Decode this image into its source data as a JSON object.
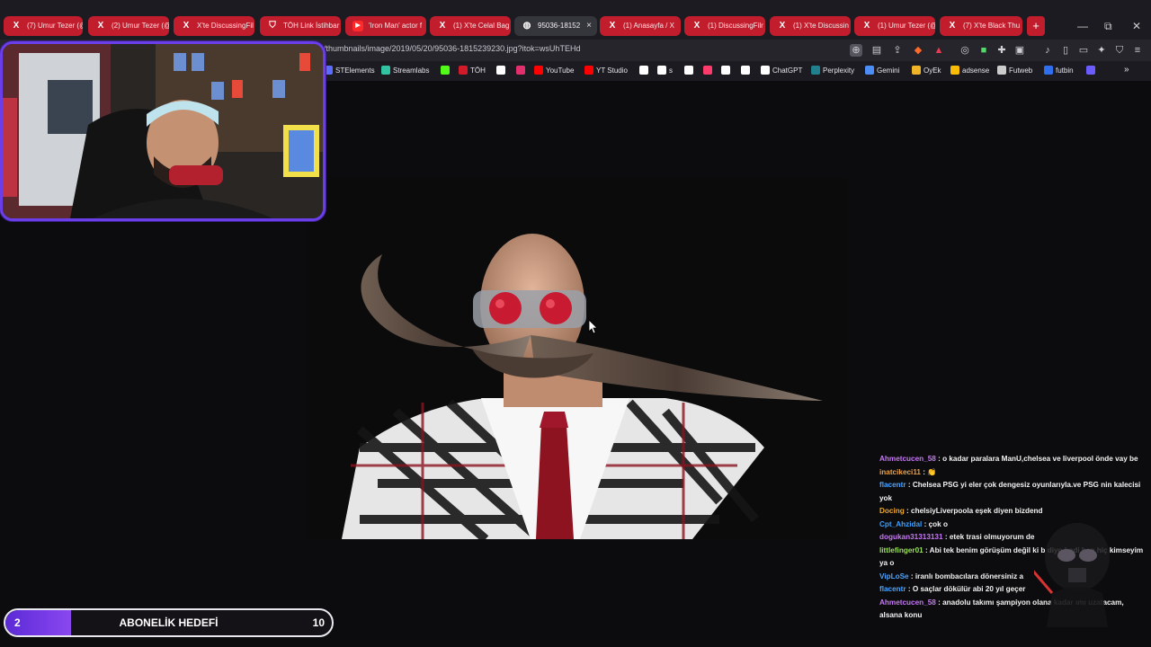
{
  "browser": {
    "tabs": [
      {
        "label": "(7) Umur Tezer (@",
        "icon": "x-icon",
        "style": "red"
      },
      {
        "label": "(2) Umur Tezer (@",
        "icon": "x-icon",
        "style": "red"
      },
      {
        "label": "X'te DiscussingFil",
        "icon": "x-icon",
        "style": "red"
      },
      {
        "label": "TÖH Link İstihbar",
        "icon": "shield-icon",
        "style": "red"
      },
      {
        "label": "'Iron Man' actor f",
        "icon": "youtube-icon",
        "style": "red"
      },
      {
        "label": "(1) X'te Celal Bag",
        "icon": "x-icon",
        "style": "red"
      },
      {
        "label": "95036-18152",
        "icon": "globe-icon",
        "style": "active",
        "close": "×"
      },
      {
        "label": "(1) Anasayfa / X",
        "icon": "x-icon",
        "style": "red"
      },
      {
        "label": "(1) DiscussingFilr",
        "icon": "x-icon",
        "style": "red"
      },
      {
        "label": "(1) X'te Discussin",
        "icon": "x-icon",
        "style": "red"
      },
      {
        "label": "(1) Umur Tezer (@",
        "icon": "x-icon",
        "style": "red"
      },
      {
        "label": "(7) X'te Black Thu",
        "icon": "x-icon",
        "style": "red"
      }
    ],
    "new_tab": "+",
    "window_controls": {
      "minimize": "—",
      "restore": "⧉",
      "close": "✕"
    },
    "url": "/thumbnails/image/2019/05/20/95036-1815239230.jpg?itok=wsUhTEHd",
    "bookmarks": [
      {
        "label": "STElements",
        "color": "#5b6cff"
      },
      {
        "label": "Streamlabs",
        "color": "#31c3a2"
      },
      {
        "label": "",
        "color": "#53fc18"
      },
      {
        "label": "TÖH",
        "color": "#d11a2a"
      },
      {
        "label": "",
        "color": "#ffffff"
      },
      {
        "label": "",
        "color": "#e1306c"
      },
      {
        "label": "YouTube",
        "color": "#ff0000"
      },
      {
        "label": "YT Studio",
        "color": "#ff0000"
      },
      {
        "label": "",
        "color": "#ffffff"
      },
      {
        "label": "s",
        "color": "#ffffff"
      },
      {
        "label": "",
        "color": "#ffffff"
      },
      {
        "label": "",
        "color": "#ff3b6b"
      },
      {
        "label": "",
        "color": "#ffffff"
      },
      {
        "label": "",
        "color": "#ffffff"
      },
      {
        "label": "ChatGPT",
        "color": "#ffffff"
      },
      {
        "label": "Perplexity",
        "color": "#20808d"
      },
      {
        "label": "Gemini",
        "color": "#4c8df6"
      },
      {
        "label": "OyEk",
        "color": "#f0b429"
      },
      {
        "label": "adsense",
        "color": "#fbbc04"
      },
      {
        "label": "Futweb",
        "color": "#cccccc"
      },
      {
        "label": "futbin",
        "color": "#2f6fed"
      },
      {
        "label": "",
        "color": "#6b5cff"
      }
    ]
  },
  "overlay": {
    "sub_goal": {
      "current": "2",
      "label": "ABONELİK HEDEFİ",
      "max": "10",
      "progress": 0.2
    },
    "chat": [
      {
        "user": "Ahmetcucen_58",
        "color": "#c678f5",
        "text": "o kadar paralara ManU,chelsea ve liverpool önde vay be"
      },
      {
        "user": "inatcikeci11",
        "color": "#e8a14a",
        "text": "👏"
      },
      {
        "user": "flacentr",
        "color": "#4aa3ff",
        "text": "Chelsea PSG yi eler çok dengesiz oyunlarıyla.ve PSG nin kalecisi yok"
      },
      {
        "user": "Docing",
        "color": "#f0a830",
        "text": "chelsiyLiverpoola eşek diyen bizdend"
      },
      {
        "user": "Cpt_Ahzidal",
        "color": "#3aa0ff",
        "text": "çok o"
      },
      {
        "user": "dogukan31313131",
        "color": "#c678f5",
        "text": "etek trasi olmuyorum de"
      },
      {
        "user": "littlefinger01",
        "color": "#9be15d",
        "text": "Abi tek benim görüşüm değil ki b               diyo hadi ben hiç kimseyim ya o"
      },
      {
        "user": "VipLoSe",
        "color": "#4aa3ff",
        "text": "iranlı bombacılara dönersiniz a"
      },
      {
        "user": "flacentr",
        "color": "#4aa3ff",
        "text": "O saçlar dökülür abi 20 yıl geçer"
      },
      {
        "user": "Ahmetcucen_58",
        "color": "#c678f5",
        "text": "anadolu takımı şampiyon olana kadar      ımı uzatacam, alsana konu"
      }
    ]
  },
  "colors": {
    "accent": "#6a3ee8",
    "tab_red": "#c21d2d"
  }
}
